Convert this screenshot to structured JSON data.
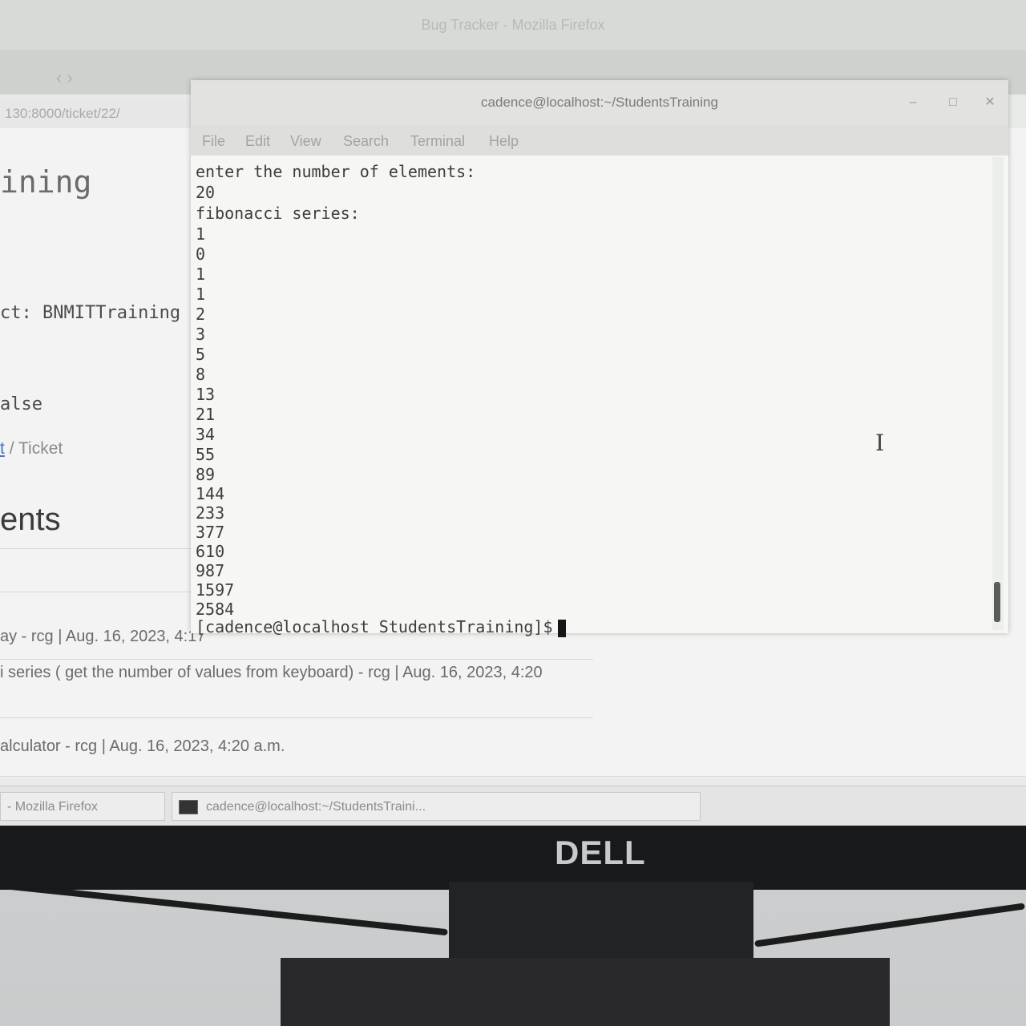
{
  "firefox": {
    "window_title": "Bug Tracker - Mozilla Firefox",
    "url_fragment": "130:8000/ticket/22/",
    "heading_partial": "ining",
    "project_label": "ct: BNMITTraining",
    "flag_text": "alse",
    "breadcrumb_link": "t",
    "breadcrumb_sep": "/",
    "breadcrumb_current": "Ticket",
    "section_heading": "ents",
    "comments": [
      "ay - rcg | Aug. 16, 2023, 4:17",
      "i series ( get the number of values from keyboard) - rcg | Aug. 16, 2023, 4:20",
      "alculator - rcg | Aug. 16, 2023, 4:20 a.m."
    ]
  },
  "terminal": {
    "title": "cadence@localhost:~/StudentsTraining",
    "menu": [
      "File",
      "Edit",
      "View",
      "Search",
      "Terminal",
      "Help"
    ],
    "lines": [
      "enter the number of elements:",
      "20",
      "fibonacci series:",
      "1",
      "0",
      "1",
      "1",
      "2",
      "3",
      "5",
      "8",
      "13",
      "21",
      "34",
      "55",
      "89",
      "144",
      "233",
      "377",
      "610",
      "987",
      "1597",
      "2584"
    ],
    "prompt": "[cadence@localhost StudentsTraining]$"
  },
  "taskbar": {
    "items": [
      "- Mozilla Firefox",
      "cadence@localhost:~/StudentsTraini..."
    ]
  },
  "monitor": {
    "brand": "DELL"
  },
  "icons": {
    "terminal_task_icon": "terminal-icon",
    "minimize": "minimize-icon",
    "maximize": "maximize-icon",
    "close": "close-icon",
    "text_cursor": "ibeam-cursor-icon"
  }
}
